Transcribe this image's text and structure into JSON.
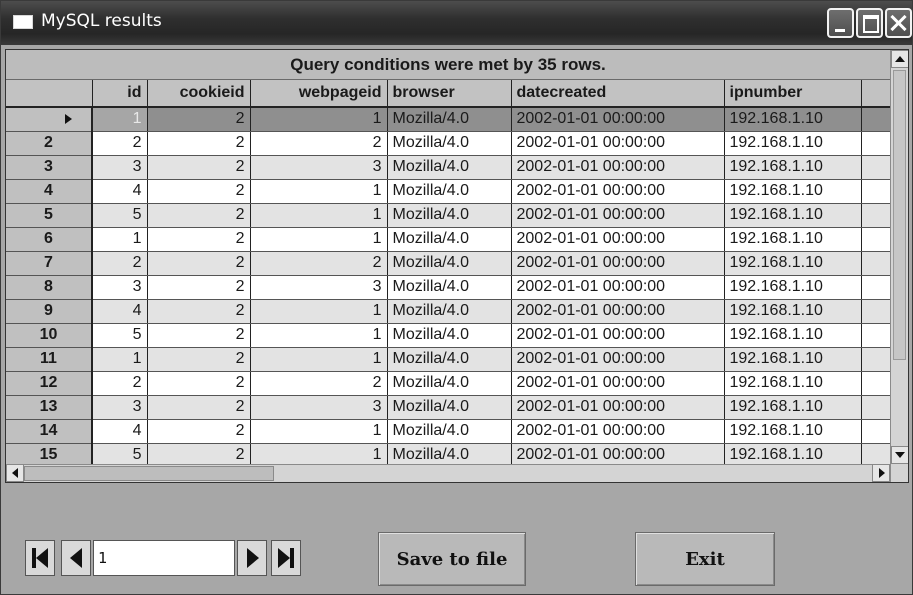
{
  "window": {
    "title": "MySQL results"
  },
  "grid": {
    "caption": "Query conditions were met by 35 rows.",
    "columns": [
      "id",
      "cookieid",
      "webpageid",
      "browser",
      "datecreated",
      "ipnumber"
    ],
    "rows": [
      {
        "rownum": "",
        "id": "1",
        "cookieid": "2",
        "webpageid": "1",
        "browser": "Mozilla/4.0",
        "datecreated": "2002-01-01 00:00:00",
        "ipnumber": "192.168.1.10"
      },
      {
        "rownum": "2",
        "id": "2",
        "cookieid": "2",
        "webpageid": "2",
        "browser": "Mozilla/4.0",
        "datecreated": "2002-01-01 00:00:00",
        "ipnumber": "192.168.1.10"
      },
      {
        "rownum": "3",
        "id": "3",
        "cookieid": "2",
        "webpageid": "3",
        "browser": "Mozilla/4.0",
        "datecreated": "2002-01-01 00:00:00",
        "ipnumber": "192.168.1.10"
      },
      {
        "rownum": "4",
        "id": "4",
        "cookieid": "2",
        "webpageid": "1",
        "browser": "Mozilla/4.0",
        "datecreated": "2002-01-01 00:00:00",
        "ipnumber": "192.168.1.10"
      },
      {
        "rownum": "5",
        "id": "5",
        "cookieid": "2",
        "webpageid": "1",
        "browser": "Mozilla/4.0",
        "datecreated": "2002-01-01 00:00:00",
        "ipnumber": "192.168.1.10"
      },
      {
        "rownum": "6",
        "id": "1",
        "cookieid": "2",
        "webpageid": "1",
        "browser": "Mozilla/4.0",
        "datecreated": "2002-01-01 00:00:00",
        "ipnumber": "192.168.1.10"
      },
      {
        "rownum": "7",
        "id": "2",
        "cookieid": "2",
        "webpageid": "2",
        "browser": "Mozilla/4.0",
        "datecreated": "2002-01-01 00:00:00",
        "ipnumber": "192.168.1.10"
      },
      {
        "rownum": "8",
        "id": "3",
        "cookieid": "2",
        "webpageid": "3",
        "browser": "Mozilla/4.0",
        "datecreated": "2002-01-01 00:00:00",
        "ipnumber": "192.168.1.10"
      },
      {
        "rownum": "9",
        "id": "4",
        "cookieid": "2",
        "webpageid": "1",
        "browser": "Mozilla/4.0",
        "datecreated": "2002-01-01 00:00:00",
        "ipnumber": "192.168.1.10"
      },
      {
        "rownum": "10",
        "id": "5",
        "cookieid": "2",
        "webpageid": "1",
        "browser": "Mozilla/4.0",
        "datecreated": "2002-01-01 00:00:00",
        "ipnumber": "192.168.1.10"
      },
      {
        "rownum": "11",
        "id": "1",
        "cookieid": "2",
        "webpageid": "1",
        "browser": "Mozilla/4.0",
        "datecreated": "2002-01-01 00:00:00",
        "ipnumber": "192.168.1.10"
      },
      {
        "rownum": "12",
        "id": "2",
        "cookieid": "2",
        "webpageid": "2",
        "browser": "Mozilla/4.0",
        "datecreated": "2002-01-01 00:00:00",
        "ipnumber": "192.168.1.10"
      },
      {
        "rownum": "13",
        "id": "3",
        "cookieid": "2",
        "webpageid": "3",
        "browser": "Mozilla/4.0",
        "datecreated": "2002-01-01 00:00:00",
        "ipnumber": "192.168.1.10"
      },
      {
        "rownum": "14",
        "id": "4",
        "cookieid": "2",
        "webpageid": "1",
        "browser": "Mozilla/4.0",
        "datecreated": "2002-01-01 00:00:00",
        "ipnumber": "192.168.1.10"
      },
      {
        "rownum": "15",
        "id": "5",
        "cookieid": "2",
        "webpageid": "1",
        "browser": "Mozilla/4.0",
        "datecreated": "2002-01-01 00:00:00",
        "ipnumber": "192.168.1.10"
      }
    ]
  },
  "navigator": {
    "position_value": "1"
  },
  "buttons": {
    "save_label": "Save to file",
    "exit_label": "Exit"
  },
  "colors": {
    "title_bar": "#2f2f2f",
    "window_background": "#a7a7a7",
    "current_row": "#8f8f8f",
    "row_header": "#c0c0c0"
  },
  "icons": {
    "title": "window-icon",
    "minimize": "minimize-icon",
    "maximize": "maximize-icon",
    "close": "close-icon",
    "record_pointer": "triangle-right-icon",
    "first": "first-record-icon",
    "prev": "prev-record-icon",
    "next": "next-record-icon",
    "last": "last-record-icon"
  }
}
